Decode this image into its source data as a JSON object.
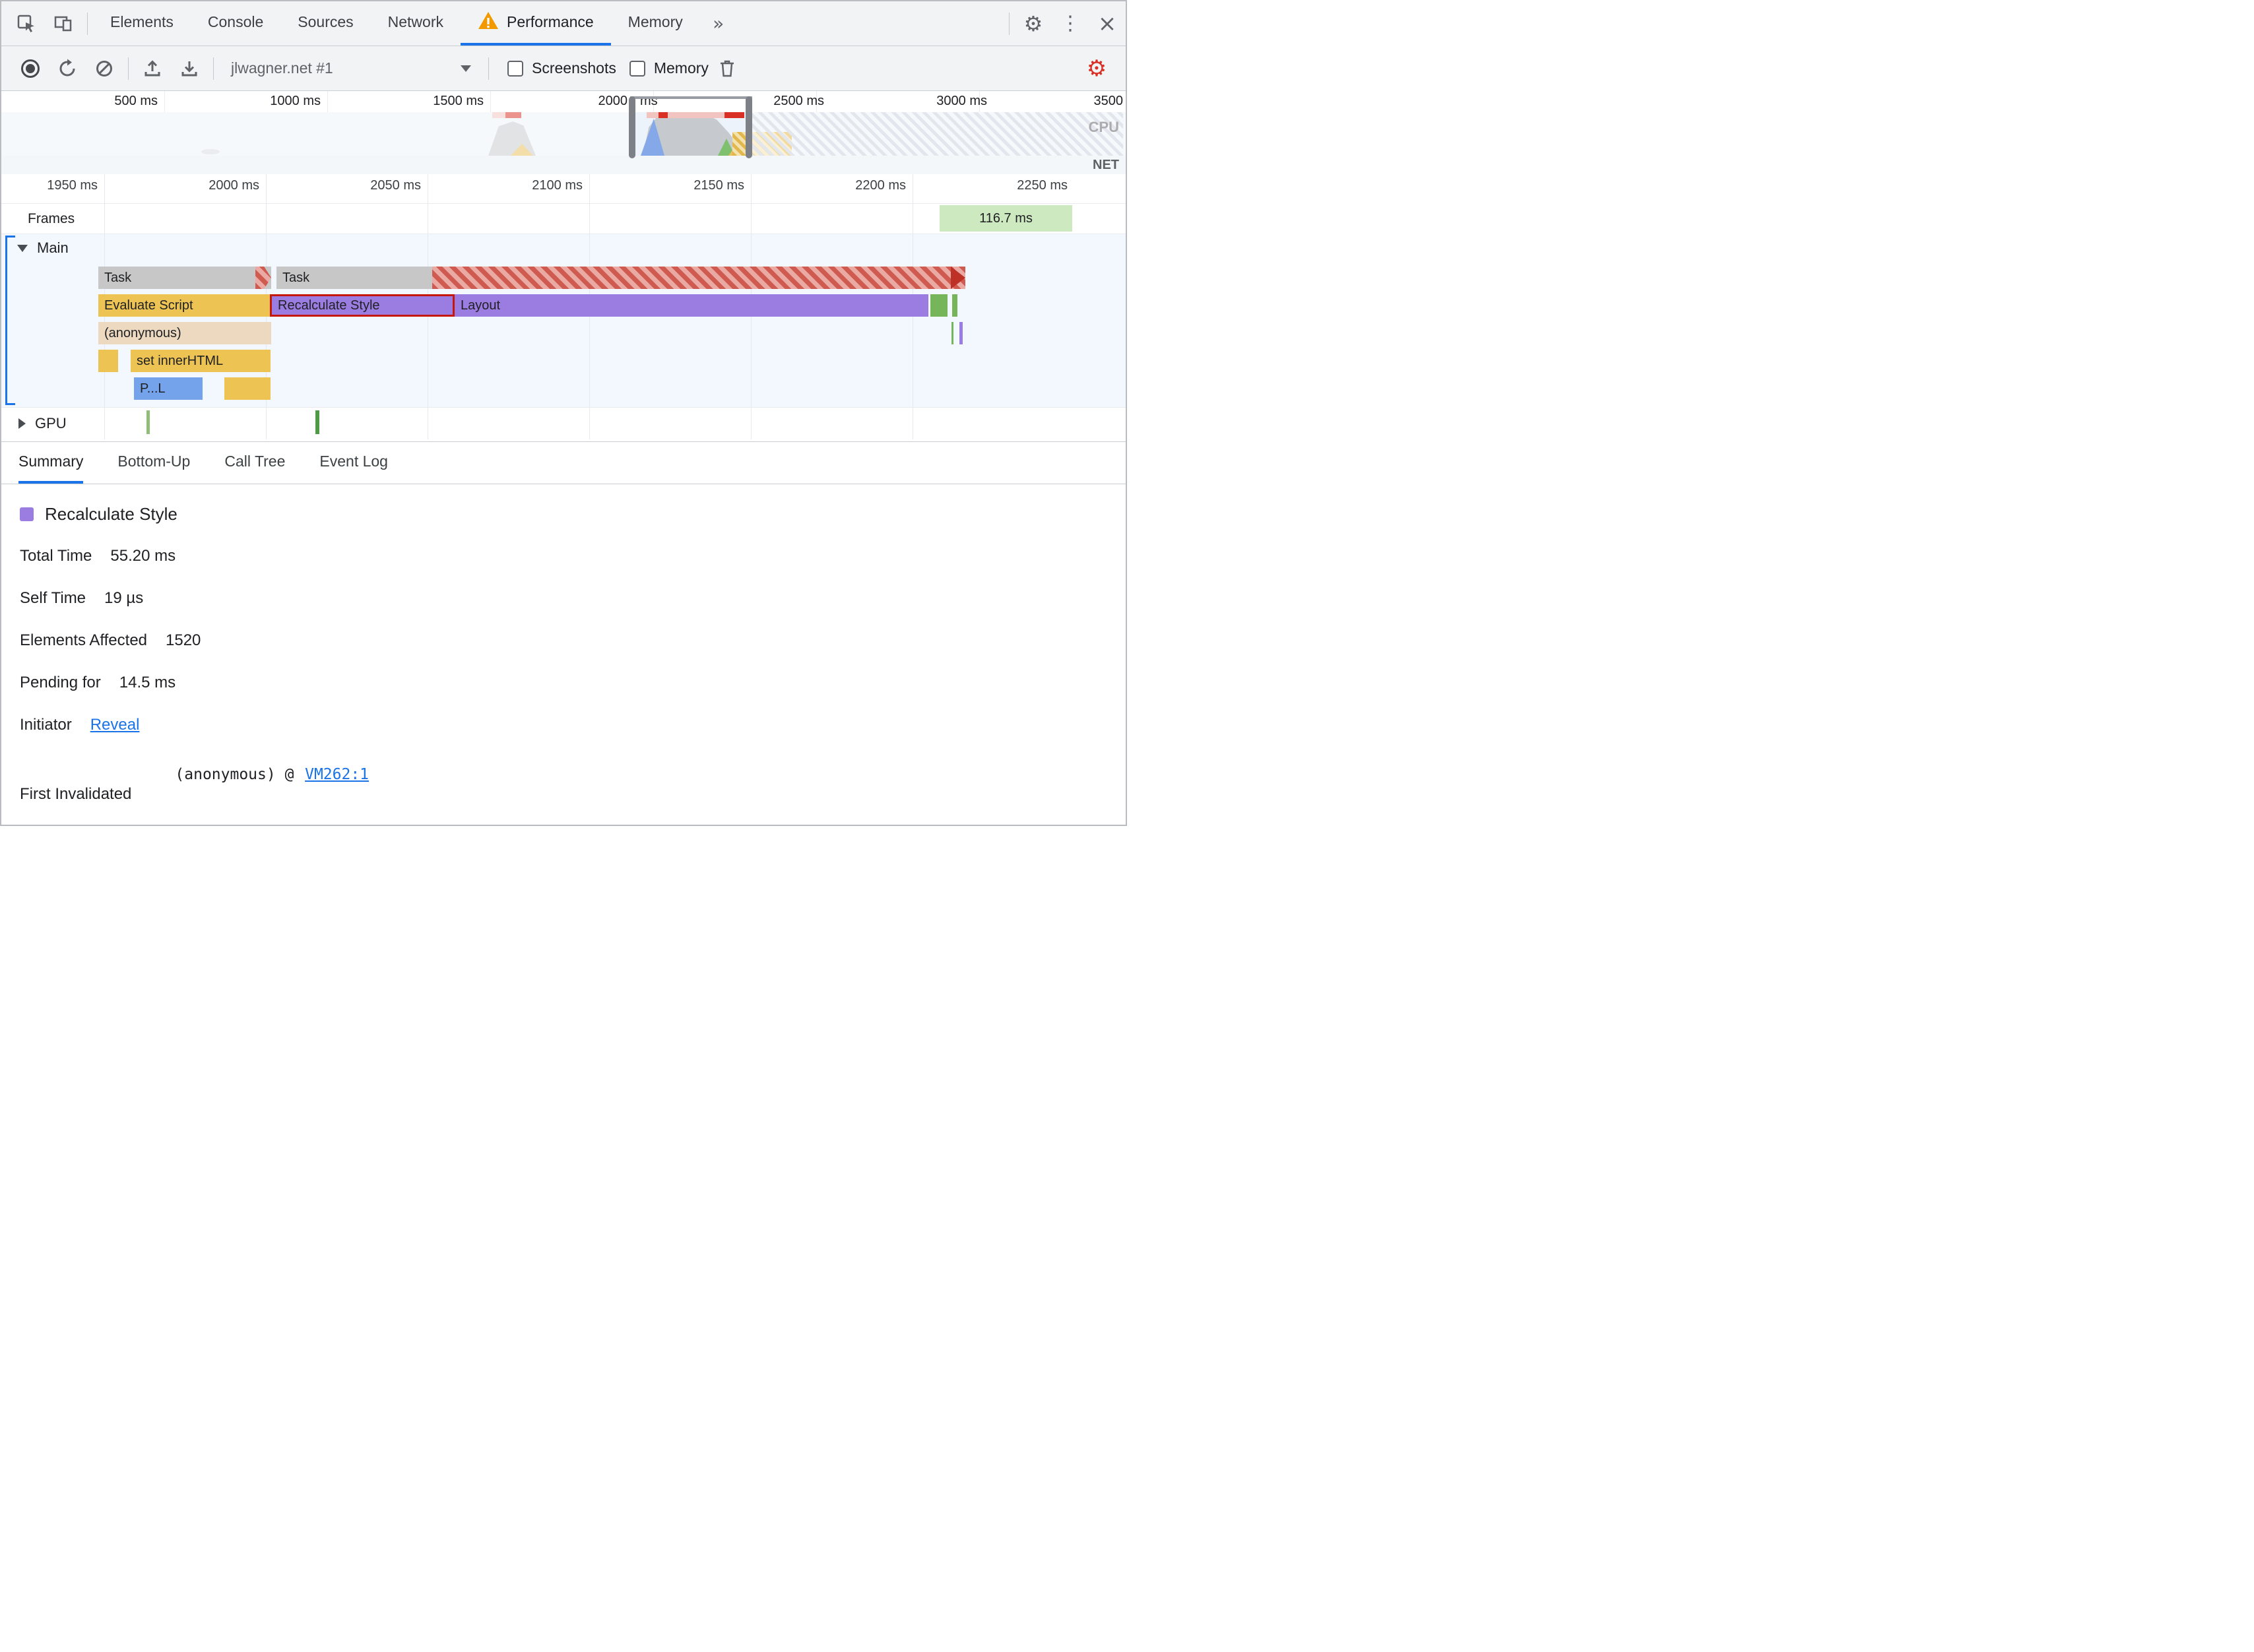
{
  "icons": {
    "settings_gear": "⚙",
    "more_vertical": "⋮",
    "close": "×",
    "overflow_chevron": "»"
  },
  "tabs": {
    "items": [
      "Elements",
      "Console",
      "Sources",
      "Network",
      "Performance",
      "Memory"
    ],
    "active": "Performance"
  },
  "toolbar": {
    "profile": "jlwagner.net #1",
    "screenshots": "Screenshots",
    "memory": "Memory"
  },
  "overview": {
    "ticks": [
      "500 ms",
      "1000 ms",
      "1500 ms",
      "2000",
      "ms",
      "2500 ms",
      "3000 ms",
      "3500"
    ],
    "cpu_label": "CPU",
    "net_label": "NET"
  },
  "ruler": {
    "ticks": [
      "1950 ms",
      "2000 ms",
      "2050 ms",
      "2100 ms",
      "2150 ms",
      "2200 ms",
      "2250 ms"
    ]
  },
  "frames": {
    "label": "Frames",
    "value": "116.7 ms"
  },
  "main_track": {
    "label": "Main",
    "task1": "Task",
    "task2": "Task",
    "evaluate_script": "Evaluate Script",
    "recalculate_style": "Recalculate Style",
    "layout": "Layout",
    "anonymous": "(anonymous)",
    "set_inner_html": "set innerHTML",
    "parse_label": "P...L"
  },
  "gpu_track": {
    "label": "GPU"
  },
  "bottom_tabs": {
    "items": [
      "Summary",
      "Bottom-Up",
      "Call Tree",
      "Event Log"
    ],
    "active": "Summary"
  },
  "summary": {
    "legend": "Recalculate Style",
    "rows": [
      [
        "Total Time",
        "55.20 ms"
      ],
      [
        "Self Time",
        "19 µs"
      ],
      [
        "Elements Affected",
        "1520"
      ],
      [
        "Pending for",
        "14.5 ms"
      ]
    ],
    "initiator": {
      "label": "Initiator",
      "link": "Reveal"
    },
    "first_invalidated": {
      "label": "First Invalidated",
      "code": "(anonymous) @",
      "link": "VM262:1"
    }
  },
  "colors": {
    "accent": "#1a73e8",
    "scripting_yellow": "#edc453",
    "rendering_purple": "#9b7ce1",
    "task_gray": "#c7c7c7",
    "long_task_red": "#d93025",
    "frame_green": "#cde9c0",
    "system_tan": "#ecd9c0",
    "parse_blue": "#74a3ec",
    "gpu_green": "#4f9a47",
    "warning_orange": "#f29900"
  }
}
